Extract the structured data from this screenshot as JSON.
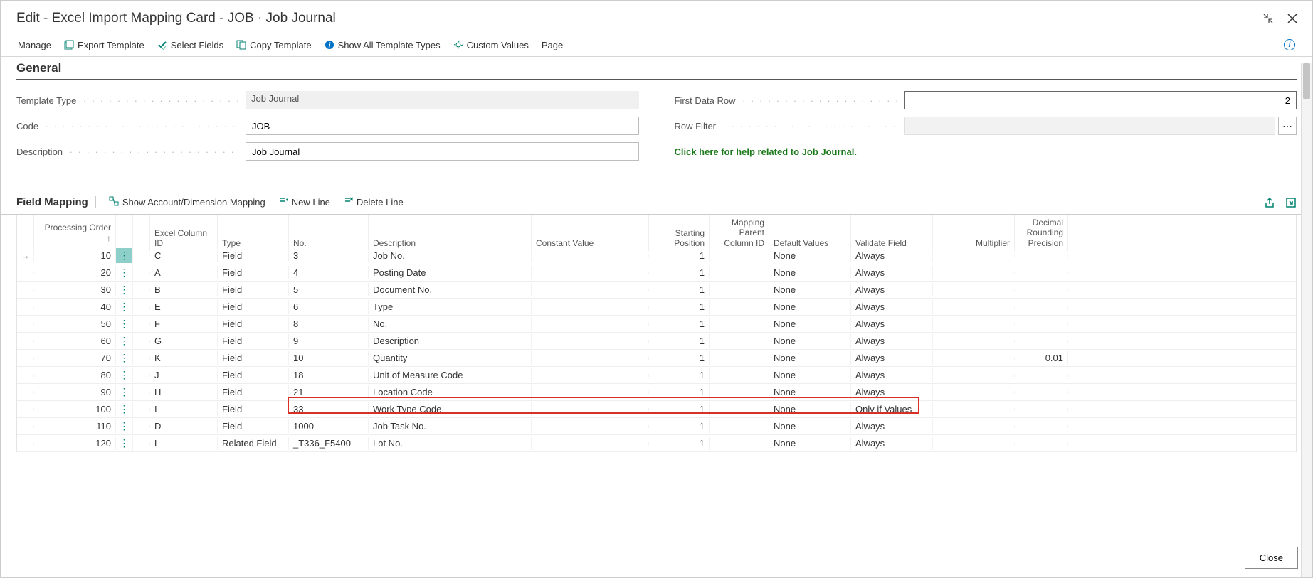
{
  "title": "Edit - Excel Import Mapping Card - JOB · Job Journal",
  "toolbar": {
    "manage": "Manage",
    "export_template": "Export Template",
    "select_fields": "Select Fields",
    "copy_template": "Copy Template",
    "show_all": "Show All Template Types",
    "custom_values": "Custom Values",
    "page": "Page"
  },
  "general": {
    "header": "General",
    "template_type_label": "Template Type",
    "template_type_value": "Job Journal",
    "code_label": "Code",
    "code_value": "JOB",
    "description_label": "Description",
    "description_value": "Job Journal",
    "first_data_row_label": "First Data Row",
    "first_data_row_value": "2",
    "row_filter_label": "Row Filter",
    "row_filter_value": "",
    "help_link": "Click here for help related to Job Journal."
  },
  "field_mapping": {
    "header": "Field Mapping",
    "show_mapping": "Show Account/Dimension Mapping",
    "new_line": "New Line",
    "delete_line": "Delete Line",
    "columns": {
      "processing_order": "Processing Order",
      "excel_column_id": "Excel Column ID",
      "type": "Type",
      "no": "No.",
      "description": "Description",
      "constant_value": "Constant Value",
      "starting_position": "Starting Position",
      "mapping_parent": "Mapping Parent Column ID",
      "default_values": "Default Values",
      "validate_field": "Validate Field",
      "multiplier": "Multiplier",
      "decimal_rounding": "Decimal Rounding Precision"
    },
    "sort_indicator": "↑",
    "rows": [
      {
        "order": "10",
        "col": "C",
        "type": "Field",
        "no": "3",
        "desc": "Job No.",
        "const": "",
        "start": "1",
        "parent": "",
        "def": "None",
        "val": "Always",
        "mult": "",
        "prec": ""
      },
      {
        "order": "20",
        "col": "A",
        "type": "Field",
        "no": "4",
        "desc": "Posting Date",
        "const": "",
        "start": "1",
        "parent": "",
        "def": "None",
        "val": "Always",
        "mult": "",
        "prec": ""
      },
      {
        "order": "30",
        "col": "B",
        "type": "Field",
        "no": "5",
        "desc": "Document No.",
        "const": "",
        "start": "1",
        "parent": "",
        "def": "None",
        "val": "Always",
        "mult": "",
        "prec": ""
      },
      {
        "order": "40",
        "col": "E",
        "type": "Field",
        "no": "6",
        "desc": "Type",
        "const": "",
        "start": "1",
        "parent": "",
        "def": "None",
        "val": "Always",
        "mult": "",
        "prec": ""
      },
      {
        "order": "50",
        "col": "F",
        "type": "Field",
        "no": "8",
        "desc": "No.",
        "const": "",
        "start": "1",
        "parent": "",
        "def": "None",
        "val": "Always",
        "mult": "",
        "prec": ""
      },
      {
        "order": "60",
        "col": "G",
        "type": "Field",
        "no": "9",
        "desc": "Description",
        "const": "",
        "start": "1",
        "parent": "",
        "def": "None",
        "val": "Always",
        "mult": "",
        "prec": ""
      },
      {
        "order": "70",
        "col": "K",
        "type": "Field",
        "no": "10",
        "desc": "Quantity",
        "const": "",
        "start": "1",
        "parent": "",
        "def": "None",
        "val": "Always",
        "mult": "",
        "prec": "0.01"
      },
      {
        "order": "80",
        "col": "J",
        "type": "Field",
        "no": "18",
        "desc": "Unit of Measure Code",
        "const": "",
        "start": "1",
        "parent": "",
        "def": "None",
        "val": "Always",
        "mult": "",
        "prec": ""
      },
      {
        "order": "90",
        "col": "H",
        "type": "Field",
        "no": "21",
        "desc": "Location Code",
        "const": "",
        "start": "1",
        "parent": "",
        "def": "None",
        "val": "Always",
        "mult": "",
        "prec": ""
      },
      {
        "order": "100",
        "col": "I",
        "type": "Field",
        "no": "33",
        "desc": "Work Type Code",
        "const": "",
        "start": "1",
        "parent": "",
        "def": "None",
        "val": "Only if Values",
        "mult": "",
        "prec": ""
      },
      {
        "order": "110",
        "col": "D",
        "type": "Field",
        "no": "1000",
        "desc": "Job Task No.",
        "const": "",
        "start": "1",
        "parent": "",
        "def": "None",
        "val": "Always",
        "mult": "",
        "prec": ""
      },
      {
        "order": "120",
        "col": "L",
        "type": "Related Field",
        "no": "_T336_F5400",
        "desc": "Lot No.",
        "const": "",
        "start": "1",
        "parent": "",
        "def": "None",
        "val": "Always",
        "mult": "",
        "prec": ""
      }
    ]
  },
  "footer": {
    "close": "Close"
  }
}
